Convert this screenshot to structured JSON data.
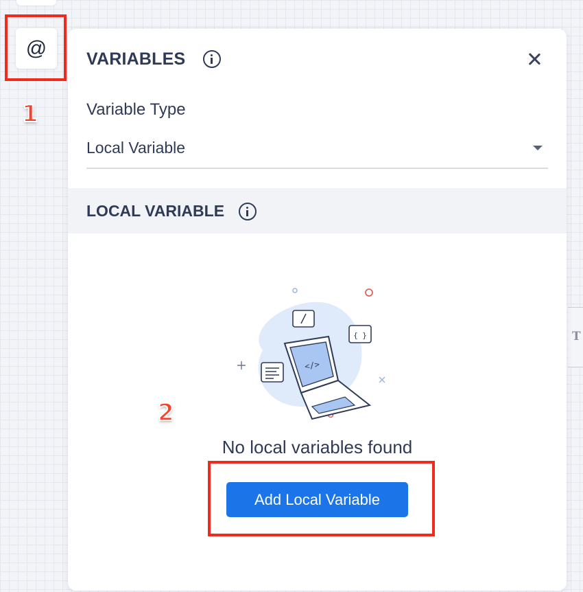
{
  "toolbar": {
    "variables_button_icon": "at-sign-icon",
    "variables_button_glyph": "@"
  },
  "annotations": {
    "step_1": "1",
    "step_2": "2",
    "highlight_color": "#ef2b1e"
  },
  "panel": {
    "title": "VARIABLES",
    "variable_type": {
      "label": "Variable Type",
      "selected": "Local Variable"
    },
    "section": {
      "title": "LOCAL VARIABLE"
    },
    "empty_state": {
      "illustration": "laptop-code-illustration",
      "message": "No local variables found",
      "button_label": "Add Local Variable"
    }
  },
  "colors": {
    "accent": "#1b74e8",
    "text": "#2f3a56",
    "section_bg": "#f2f3f7"
  }
}
